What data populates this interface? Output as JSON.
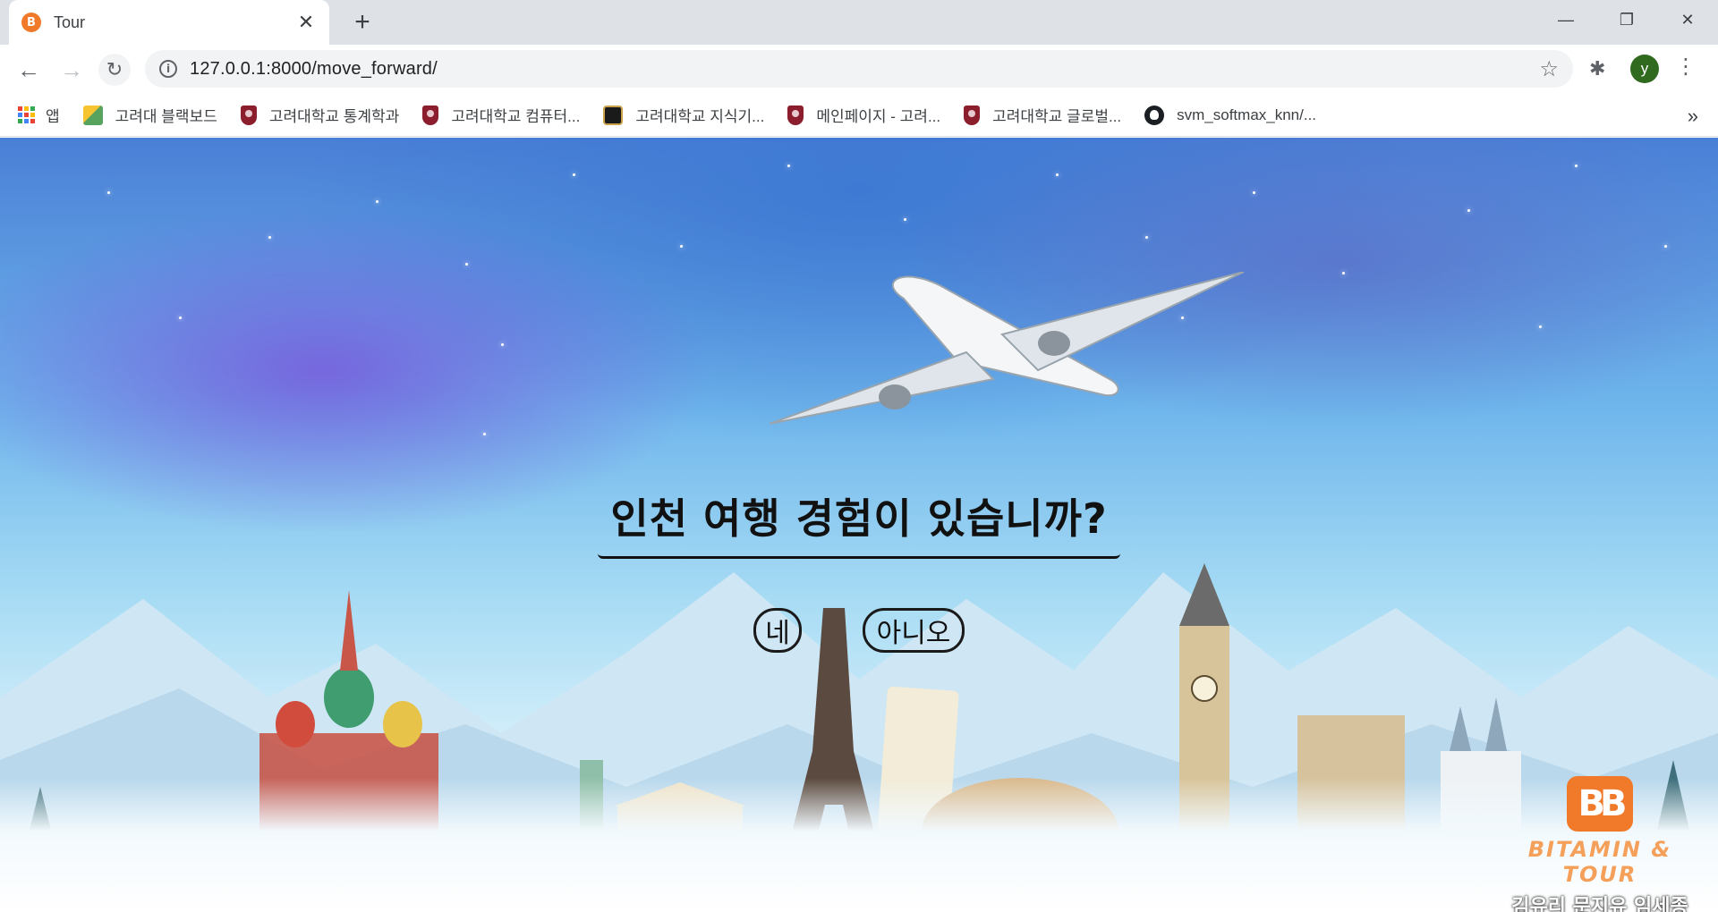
{
  "browser": {
    "tab": {
      "favicon_text": "B",
      "title": "Tour",
      "close": "✕"
    },
    "new_tab": "+",
    "window_controls": {
      "minimize": "—",
      "restore": "❐",
      "close": "✕"
    },
    "nav": {
      "back": "←",
      "forward": "→",
      "reload": "↻"
    },
    "url": "127.0.0.1:8000/move_forward/",
    "bookmark_star": "☆",
    "extensions_icon": "✱",
    "profile_initial": "y",
    "menu": "⋮"
  },
  "bookmarks": {
    "apps_label": "앱",
    "items": [
      {
        "label": "고려대 블랙보드",
        "icon": "pencil-icon"
      },
      {
        "label": "고려대학교 통계학과",
        "icon": "shield-icon"
      },
      {
        "label": "고려대학교 컴퓨터...",
        "icon": "shield-icon"
      },
      {
        "label": "고려대학교 지식기...",
        "icon": "tiger-icon"
      },
      {
        "label": "메인페이지 - 고려...",
        "icon": "shield-icon"
      },
      {
        "label": "고려대학교 글로벌...",
        "icon": "shield-icon"
      },
      {
        "label": "svm_softmax_knn/...",
        "icon": "github-icon"
      }
    ],
    "more": "»"
  },
  "page": {
    "question": "인천 여행 경험이 있습니까?",
    "yes_label": "네",
    "no_label": "아니오",
    "brand": {
      "name": "BITAMIN & TOUR",
      "members": "김유리 문지유 임세종"
    }
  }
}
